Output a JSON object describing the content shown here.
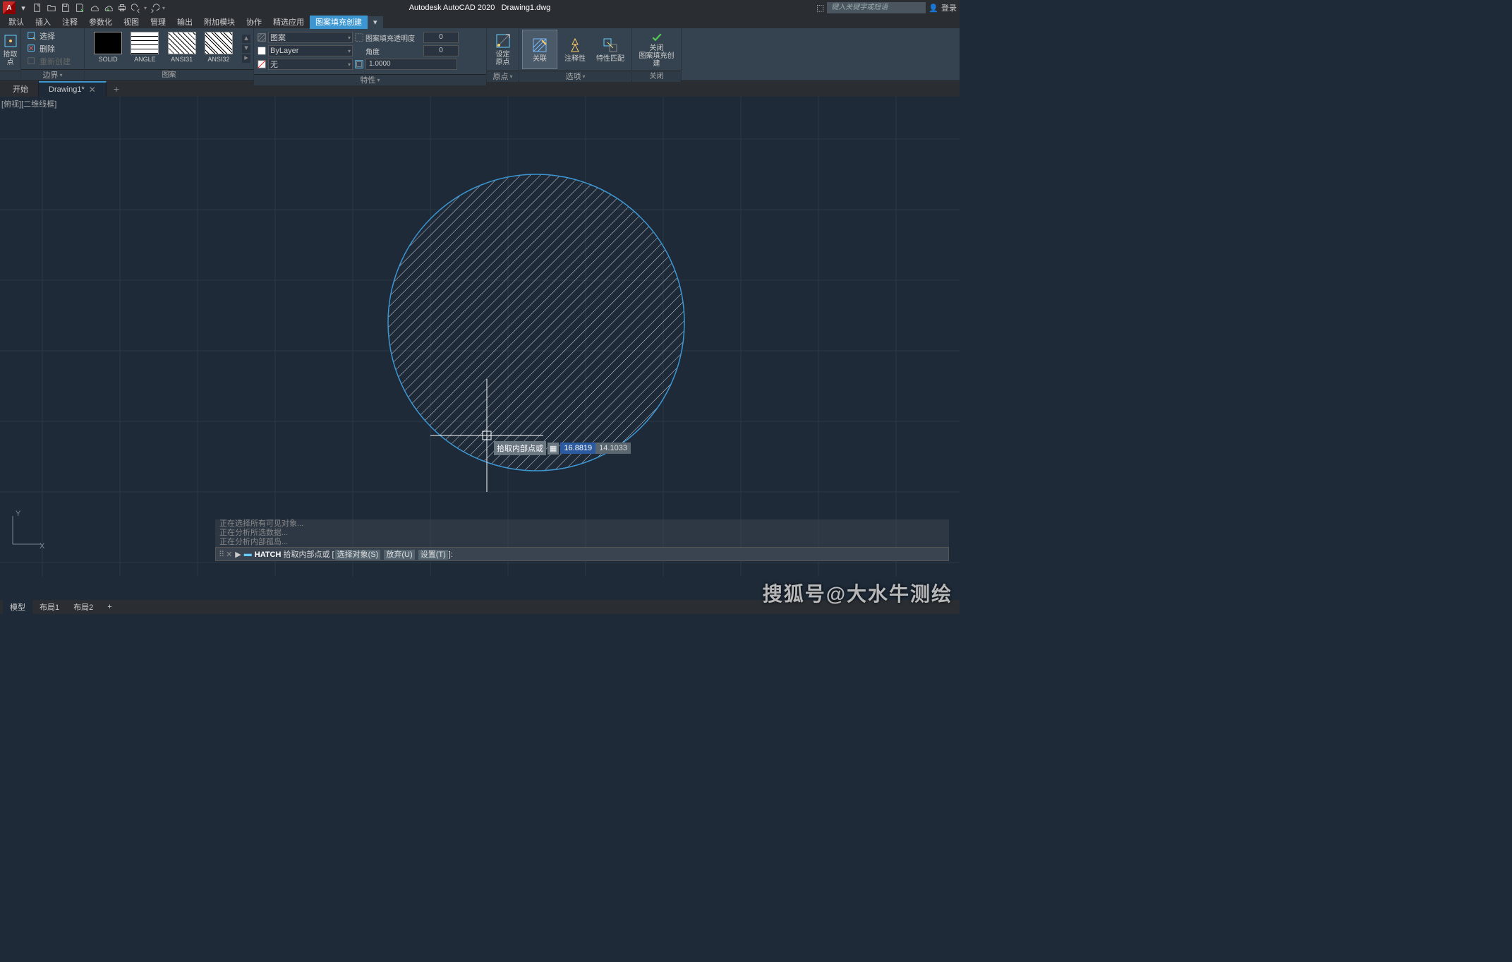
{
  "title": {
    "app": "Autodesk AutoCAD 2020",
    "file": "Drawing1.dwg"
  },
  "search": {
    "placeholder": "键入关键字或短语"
  },
  "login": {
    "label": "登录"
  },
  "menu": [
    "默认",
    "插入",
    "注释",
    "参数化",
    "视图",
    "管理",
    "输出",
    "附加模块",
    "协作",
    "精选应用",
    "图案填充创建"
  ],
  "menu_active": 10,
  "menu_expand": "▾",
  "ribbon": {
    "boundary": {
      "select": "选择",
      "remove": "删除",
      "recreate": "重新创建",
      "pick": "拾取点",
      "title": "边界"
    },
    "pattern": {
      "title": "图案",
      "swatches": [
        "SOLID",
        "ANGLE",
        "ANSI31",
        "ANSI32"
      ]
    },
    "properties": {
      "title": "特性",
      "pattern_label": "图案",
      "layer": "ByLayer",
      "none": "无",
      "transparency_label": "图案填充透明度",
      "transparency_value": "0",
      "angle_label": "角度",
      "angle_value": "0",
      "scale_value": "1.0000"
    },
    "origin": {
      "label": "设定\n原点",
      "title": "原点"
    },
    "options": {
      "assoc": "关联",
      "annotative": "注释性",
      "match": "特性匹配",
      "title": "选项"
    },
    "close": {
      "label": "关闭\n图案填充创建",
      "title": "关闭"
    }
  },
  "tabs": {
    "start": "开始",
    "drawing": "Drawing1*"
  },
  "viewport": {
    "label": "俯视][二维线框"
  },
  "cursor": {
    "tip": "拾取内部点或",
    "val1": "16.8819",
    "val2": "14.1033"
  },
  "axes": {
    "y": "Y",
    "x": "X"
  },
  "cmd": {
    "history": [
      "正在选择所有可见对象...",
      "正在分析所选数据...",
      "正在分析内部孤岛..."
    ],
    "prefix": "HATCH",
    "text": "拾取内部点或 [",
    "opts": [
      "选择对象(S)",
      "放弃(U)",
      "设置(T)"
    ],
    "suffix": "]:"
  },
  "layouts": [
    "模型",
    "布局1",
    "布局2"
  ],
  "watermark": "搜狐号@大水牛测绘"
}
